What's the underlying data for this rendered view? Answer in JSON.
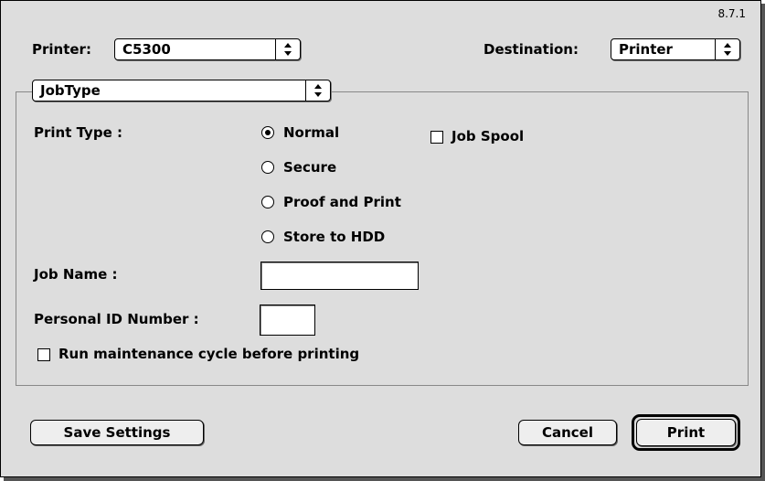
{
  "version": "8.7.1",
  "printer": {
    "label": "Printer:",
    "value": "C5300"
  },
  "destination": {
    "label": "Destination:",
    "value": "Printer"
  },
  "panel_menu": {
    "value": "JobType"
  },
  "print_type": {
    "label": "Print Type :",
    "options": [
      {
        "label": "Normal",
        "selected": true
      },
      {
        "label": "Secure",
        "selected": false
      },
      {
        "label": "Proof and Print",
        "selected": false
      },
      {
        "label": "Store to HDD",
        "selected": false
      }
    ]
  },
  "job_spool": {
    "label": "Job Spool",
    "checked": false
  },
  "job_name": {
    "label": "Job Name :",
    "value": ""
  },
  "pin": {
    "label": "Personal ID Number :",
    "value": ""
  },
  "maintenance": {
    "label": "Run maintenance cycle before printing",
    "checked": false
  },
  "buttons": {
    "save": "Save Settings",
    "cancel": "Cancel",
    "print": "Print"
  }
}
